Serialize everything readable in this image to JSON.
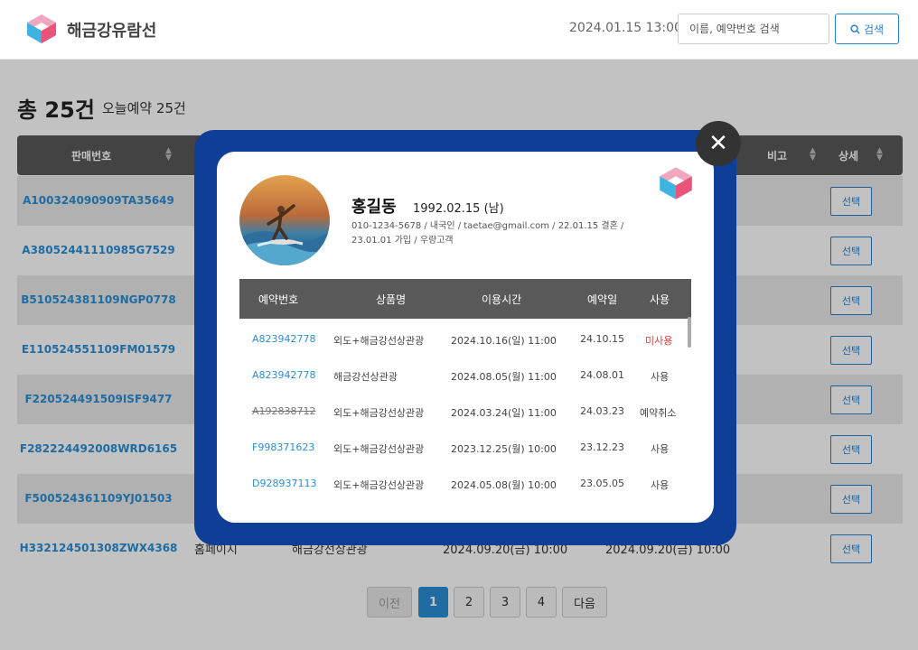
{
  "header": {
    "brand": "해금강유람선",
    "datetime": "2024.01.15 13:00",
    "search_placeholder": "이름, 예약번호 검색",
    "search_button": "검색"
  },
  "summary": {
    "total": "총 25건",
    "today": "오늘예약 25건"
  },
  "table": {
    "columns": {
      "sale_no": "판매번호",
      "note": "비고",
      "detail": "상세"
    },
    "select_label": "선택",
    "rows": [
      {
        "code": "A100324090909TA35649"
      },
      {
        "code": "A38052441110985G7529"
      },
      {
        "code": "B510524381109NGP0778"
      },
      {
        "code": "E110524551109FM01579"
      },
      {
        "code": "F220524491509ISF9477"
      },
      {
        "code": "F282224492008WRD6165"
      },
      {
        "code": "F500524361109YJ01503"
      },
      {
        "code": "H332124501308ZWX4368",
        "channel": "홈페이지",
        "product": "해금강선상관광",
        "time": "2024.09.20(금) 10:00",
        "date": "2024.09.20(금) 10:00"
      }
    ]
  },
  "pagination": {
    "prev": "이전",
    "pages": [
      "1",
      "2",
      "3",
      "4"
    ],
    "next": "다음",
    "current": "1"
  },
  "modal": {
    "name": "홍길동",
    "birth": "1992.02.15 (남)",
    "info_line1": "010-1234-5678 /  내국인 /  taetae@gmail.com /  22.01.15 결혼 /",
    "info_line2": "23.01.01 가입 /  우량고객",
    "columns": {
      "res_no": "예약번호",
      "product": "상품명",
      "time": "이용시간",
      "date": "예약일",
      "use": "사용"
    },
    "rows": [
      {
        "res_no": "A823942778",
        "product": "외도+해금강선상관광",
        "time": "2024.10.16(일) 11:00",
        "date": "24.10.15",
        "use": "미사용"
      },
      {
        "res_no": "A823942778",
        "product": "해금강선상관광",
        "time": "2024.08.05(월) 11:00",
        "date": "24.08.01",
        "use": "사용"
      },
      {
        "res_no": "A192838712",
        "product": "외도+해금강선상관광",
        "time": "2024.03.24(일) 11:00",
        "date": "24.03.23",
        "use": "예약취소"
      },
      {
        "res_no": "F998371623",
        "product": "외도+해금강선상관광",
        "time": "2023.12.25(월) 10:00",
        "date": "23.12.23",
        "use": "사용"
      },
      {
        "res_no": "D928937113",
        "product": "외도+해금강선상관광",
        "time": "2024.05.08(월) 10:00",
        "date": "23.05.05",
        "use": "사용"
      }
    ]
  },
  "colors": {
    "accent": "#2a8fd6",
    "modal_frame": "#0e3e96",
    "header_row": "#595959",
    "unused": "#e53935"
  },
  "icons": {
    "logo": "cube-logo-icon",
    "search": "search-icon",
    "close": "close-icon",
    "sort": "sort-icon"
  }
}
